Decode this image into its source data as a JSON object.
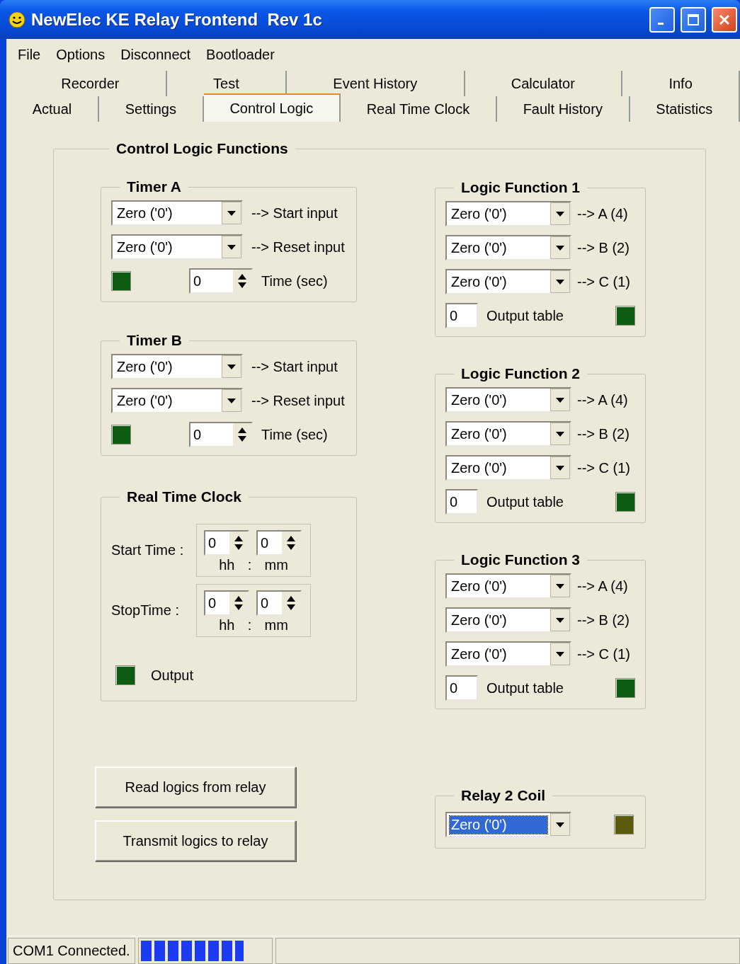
{
  "window": {
    "title": "NewElec KE Relay Frontend  Rev 1c"
  },
  "menu": [
    "File",
    "Options",
    "Disconnect",
    "Bootloader"
  ],
  "tab_rows": [
    [
      {
        "label": "Recorder",
        "selected": false
      },
      {
        "label": "Test",
        "selected": false
      },
      {
        "label": "Event History",
        "selected": false
      },
      {
        "label": "Calculator",
        "selected": false
      },
      {
        "label": "Info",
        "selected": false
      }
    ],
    [
      {
        "label": "Actual",
        "selected": false
      },
      {
        "label": "Settings",
        "selected": false
      },
      {
        "label": "Control Logic",
        "selected": true
      },
      {
        "label": "Real Time Clock",
        "selected": false
      },
      {
        "label": "Fault History",
        "selected": false
      },
      {
        "label": "Statistics",
        "selected": false
      }
    ]
  ],
  "group": {
    "title": "Control Logic Functions"
  },
  "timers": [
    {
      "title": "Timer A",
      "inputs": [
        {
          "value": "Zero ('0')",
          "label": "--> Start input"
        },
        {
          "value": "Zero ('0')",
          "label": "--> Reset input"
        }
      ],
      "led": {
        "color": "#0d5c12"
      },
      "time": {
        "value": "0",
        "label": "Time (sec)"
      }
    },
    {
      "title": "Timer B",
      "inputs": [
        {
          "value": "Zero ('0')",
          "label": "--> Start input"
        },
        {
          "value": "Zero ('0')",
          "label": "--> Reset input"
        }
      ],
      "led": {
        "color": "#0d5c12"
      },
      "time": {
        "value": "0",
        "label": "Time (sec)"
      }
    }
  ],
  "rtc": {
    "title": "Real Time Clock",
    "rows": [
      {
        "label": "Start Time :",
        "hh": "0",
        "mm": "0",
        "hh_label": "hh",
        "separator": ":",
        "mm_label": "mm"
      },
      {
        "label": "StopTime :",
        "hh": "0",
        "mm": "0",
        "hh_label": "hh",
        "separator": ":",
        "mm_label": "mm"
      }
    ],
    "output": {
      "label": "Output",
      "color": "#0d5c12"
    }
  },
  "buttons": [
    "Read logics from relay",
    "Transmit logics to relay"
  ],
  "logic_functions": [
    {
      "title": "Logic Function 1",
      "inputs": [
        {
          "value": "Zero ('0')",
          "label": "--> A (4)"
        },
        {
          "value": "Zero ('0')",
          "label": "--> B (2)"
        },
        {
          "value": "Zero ('0')",
          "label": "--> C (1)"
        }
      ],
      "output_value": "0",
      "output_label": "Output table",
      "color": "#0d5c12"
    },
    {
      "title": "Logic Function 2",
      "inputs": [
        {
          "value": "Zero ('0')",
          "label": "--> A (4)"
        },
        {
          "value": "Zero ('0')",
          "label": "--> B (2)"
        },
        {
          "value": "Zero ('0')",
          "label": "--> C (1)"
        }
      ],
      "output_value": "0",
      "output_label": "Output table",
      "color": "#0d5c12"
    },
    {
      "title": "Logic Function 3",
      "inputs": [
        {
          "value": "Zero ('0')",
          "label": "--> A (4)"
        },
        {
          "value": "Zero ('0')",
          "label": "--> B (2)"
        },
        {
          "value": "Zero ('0')",
          "label": "--> C (1)"
        }
      ],
      "output_value": "0",
      "output_label": "Output table",
      "color": "#0d5c12"
    }
  ],
  "relay_coil": {
    "title": "Relay 2 Coil",
    "value": "Zero ('0')",
    "focused": true,
    "color": "#5c5a0d"
  },
  "status_bar": {
    "text": "COM1 Connected.",
    "level": 0.8
  }
}
